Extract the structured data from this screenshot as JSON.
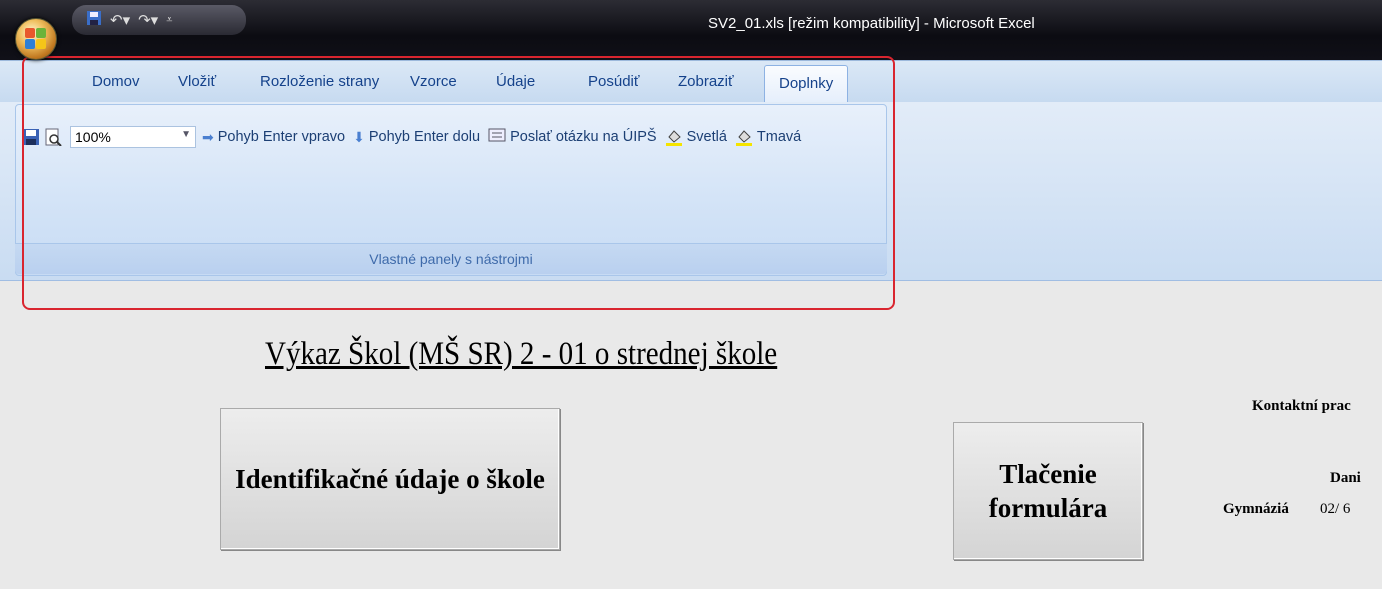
{
  "window": {
    "title": "SV2_01.xls  [režim kompatibility] - Microsoft Excel"
  },
  "quick_access": {
    "icons": [
      "save-icon",
      "undo-icon",
      "redo-icon",
      "customize-icon"
    ]
  },
  "tabs": [
    {
      "label": "Domov"
    },
    {
      "label": "Vložiť"
    },
    {
      "label": "Rozloženie strany"
    },
    {
      "label": "Vzorce"
    },
    {
      "label": "Údaje"
    },
    {
      "label": "Posúdiť"
    },
    {
      "label": "Zobraziť"
    },
    {
      "label": "Doplnky",
      "active": true
    }
  ],
  "toolbar": {
    "zoom_value": "100%",
    "move_right_label": "Pohyb Enter vpravo",
    "move_down_label": "Pohyb Enter dolu",
    "send_question_label": "Poslať otázku na ÚIPŠ",
    "light_label": "Svetlá",
    "dark_label": "Tmavá",
    "group_label": "Vlastné panely s nástrojmi"
  },
  "sheet": {
    "title": "Výkaz Škol (MŠ SR) 2 - 01 o strednej škole",
    "id_button": "Identifikačné údaje o škole",
    "print_button_line1": "Tlačenie",
    "print_button_line2": "formulára",
    "contact": "Kontaktní prac",
    "school_type": "Gymnáziá",
    "name_fragment": "Dani",
    "phone_fragment": "02/ 6"
  },
  "colors": {
    "highlight_box": "#d9252f",
    "ribbon_text": "#15428b"
  }
}
